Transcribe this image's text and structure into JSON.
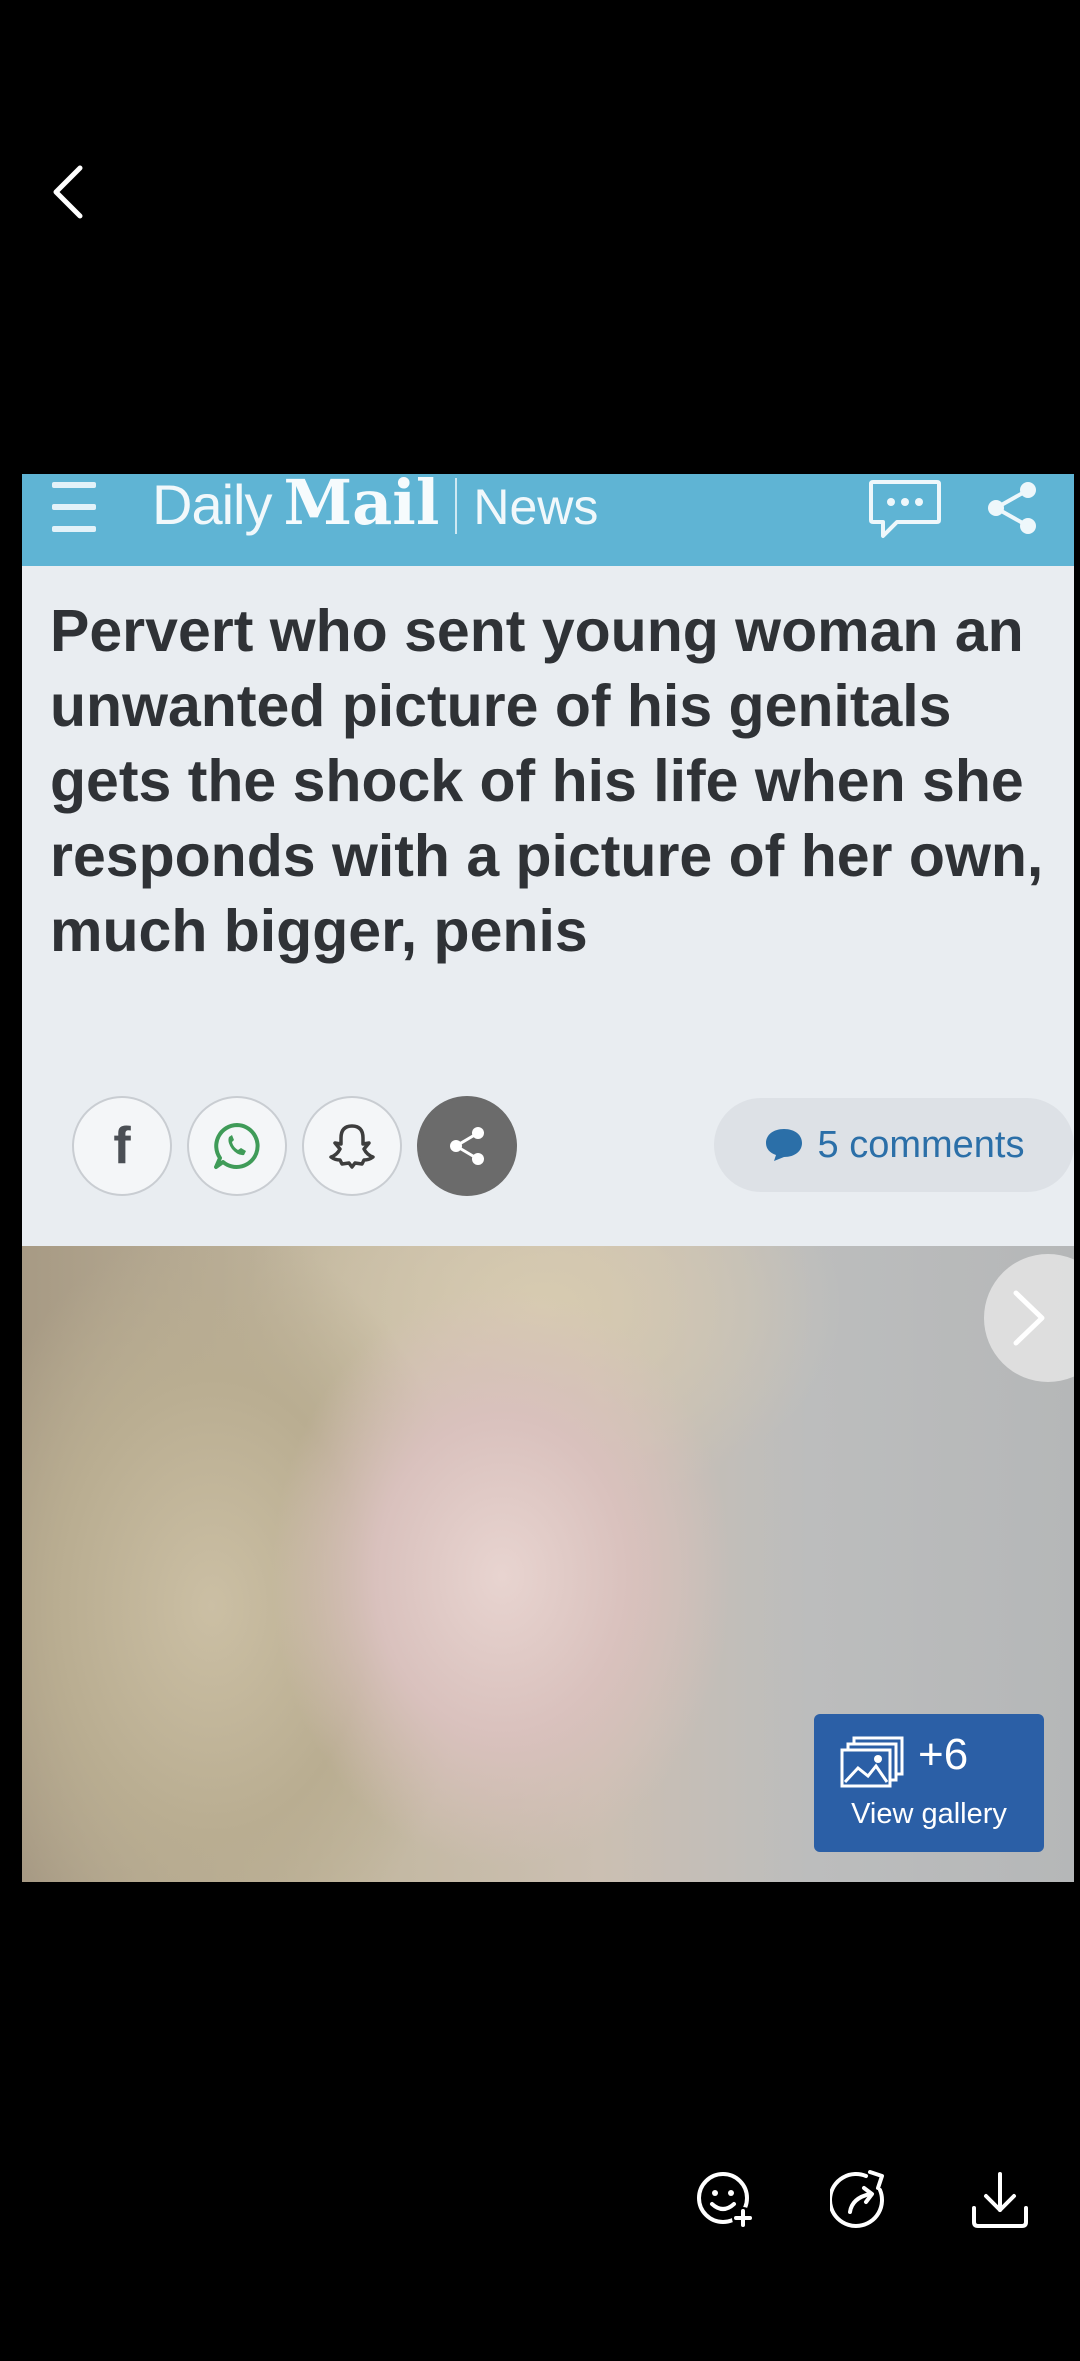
{
  "viewer": {
    "back_icon": "chevron-left-icon",
    "toolbar": [
      {
        "icon": "emoji-add-icon"
      },
      {
        "icon": "share-forward-icon"
      },
      {
        "icon": "download-icon"
      }
    ]
  },
  "article": {
    "brand_daily": "Daily",
    "brand_mail": "Mail",
    "section": "News",
    "header_colors": {
      "bar": "#5fb4d4"
    },
    "headline": "Pervert who sent young woman an unwanted picture of his genitals gets the shock of his life when she responds with a picture of her own, much bigger, penis",
    "share_buttons": [
      {
        "icon": "facebook-icon",
        "glyph": "f"
      },
      {
        "icon": "whatsapp-icon"
      },
      {
        "icon": "snapchat-icon"
      },
      {
        "icon": "share-icon"
      }
    ],
    "comments_label": "5 comments",
    "gallery": {
      "count": "+6",
      "label": "View gallery"
    }
  }
}
